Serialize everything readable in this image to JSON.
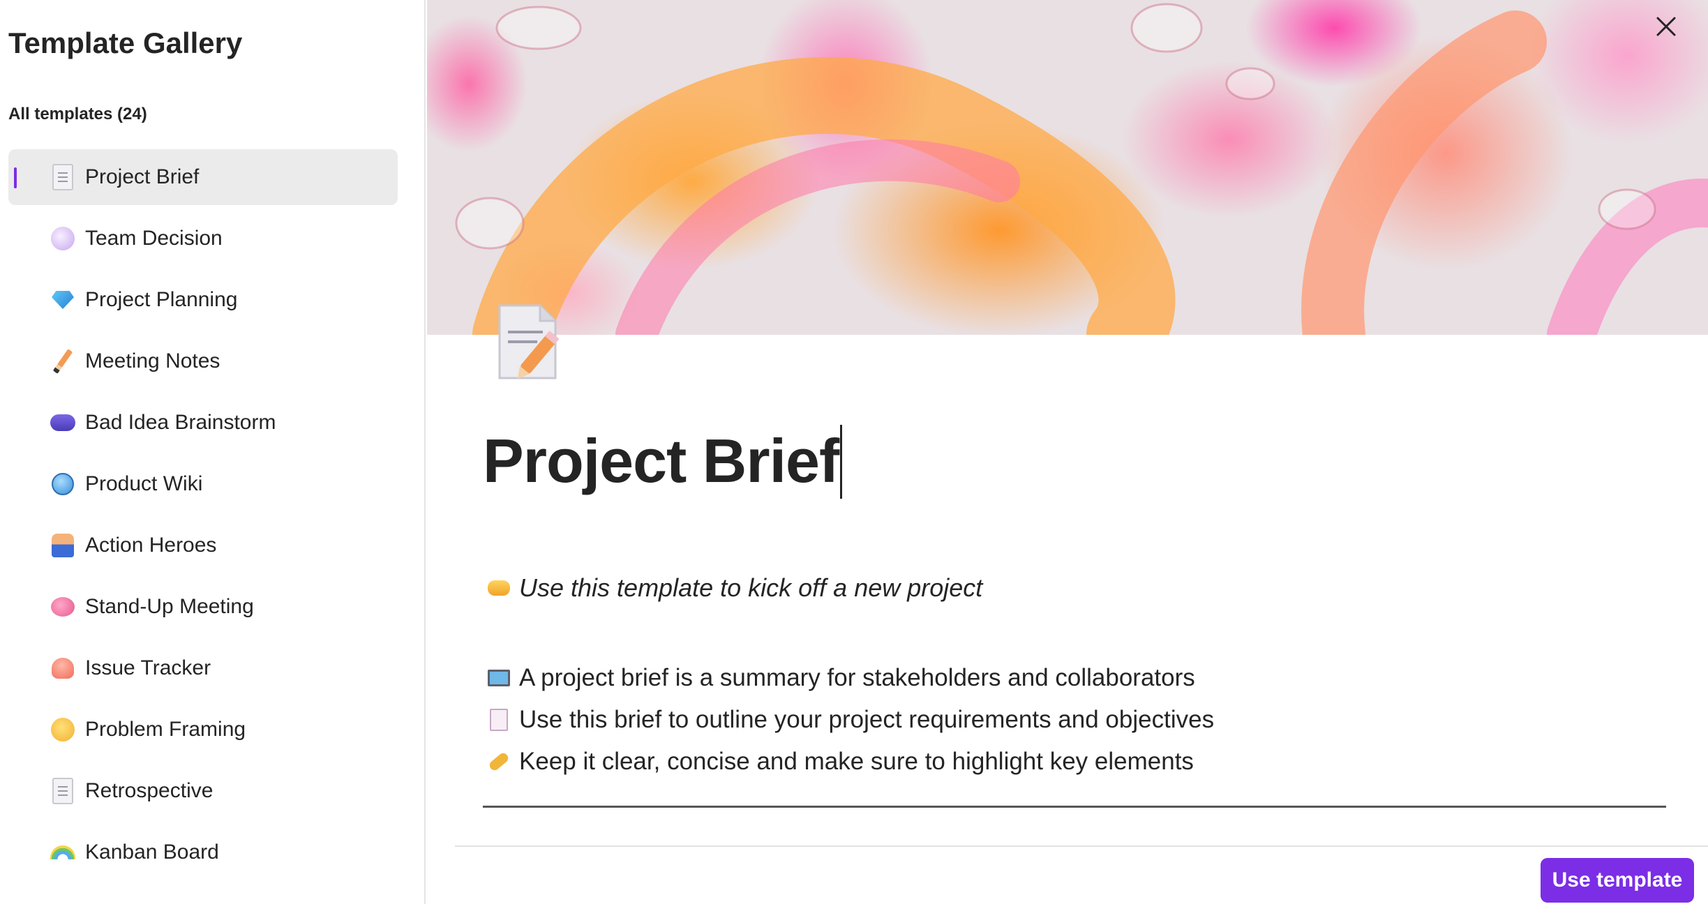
{
  "sidebar": {
    "title": "Template Gallery",
    "count_label": "All templates (24)",
    "items": [
      {
        "label": "Project Brief",
        "icon": "memo-icon"
      },
      {
        "label": "Team Decision",
        "icon": "unicorn-icon"
      },
      {
        "label": "Project Planning",
        "icon": "gem-icon"
      },
      {
        "label": "Meeting Notes",
        "icon": "pencil-icon"
      },
      {
        "label": "Bad Idea Brainstorm",
        "icon": "storm-cloud-icon"
      },
      {
        "label": "Product Wiki",
        "icon": "globe-icon"
      },
      {
        "label": "Action Heroes",
        "icon": "superhero-icon"
      },
      {
        "label": "Stand-Up Meeting",
        "icon": "brain-icon"
      },
      {
        "label": "Issue Tracker",
        "icon": "octopus-icon"
      },
      {
        "label": "Problem Framing",
        "icon": "thinking-face-icon"
      },
      {
        "label": "Retrospective",
        "icon": "document-icon"
      },
      {
        "label": "Kanban Board",
        "icon": "rainbow-icon"
      }
    ],
    "active_index": 0,
    "accent_color": "#7b2ee6"
  },
  "main": {
    "title": "Project Brief",
    "tagline": "Use this template to kick off a new project",
    "bullets": [
      {
        "icon": "laptop-icon",
        "text": "A project brief is a summary for stakeholders and collaborators"
      },
      {
        "icon": "bookmark-tabs-icon",
        "text": "Use this brief to outline your project requirements and objectives"
      },
      {
        "icon": "key-icon",
        "text": "Keep it clear, concise and make sure to highlight key elements"
      }
    ],
    "use_template_label": "Use template",
    "button_color": "#7b2ee6"
  }
}
